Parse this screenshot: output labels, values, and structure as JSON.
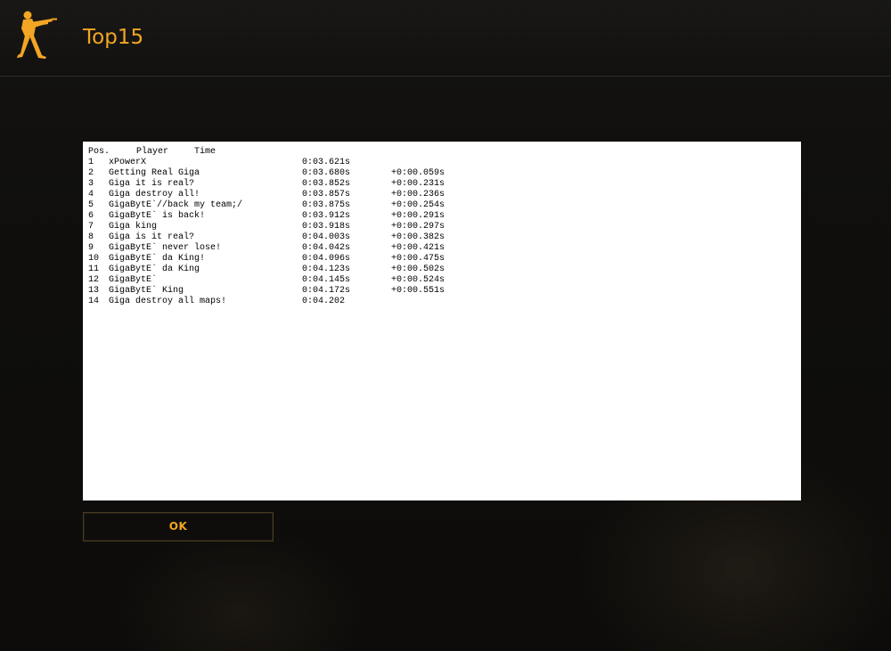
{
  "window": {
    "title": "Top15",
    "logo_icon": "counter-strike-soldier-icon",
    "accent_color": "#f3a623"
  },
  "table": {
    "headers": {
      "pos": "Pos.",
      "player": "Player",
      "time": "Time"
    },
    "rows": [
      {
        "pos": "1",
        "player": "xPowerX",
        "time": "0:03.621s",
        "diff": ""
      },
      {
        "pos": "2",
        "player": "Getting Real Giga",
        "time": "0:03.680s",
        "diff": "+0:00.059s"
      },
      {
        "pos": "3",
        "player": "Giga it is real?",
        "time": "0:03.852s",
        "diff": "+0:00.231s"
      },
      {
        "pos": "4",
        "player": "Giga destroy all!",
        "time": "0:03.857s",
        "diff": "+0:00.236s"
      },
      {
        "pos": "5",
        "player": "GigaBytE`//back my team;/",
        "time": "0:03.875s",
        "diff": "+0:00.254s"
      },
      {
        "pos": "6",
        "player": "GigaBytE` is back!",
        "time": "0:03.912s",
        "diff": "+0:00.291s"
      },
      {
        "pos": "7",
        "player": "Giga king",
        "time": "0:03.918s",
        "diff": "+0:00.297s"
      },
      {
        "pos": "8",
        "player": "Giga is it real?",
        "time": "0:04.003s",
        "diff": "+0:00.382s"
      },
      {
        "pos": "9",
        "player": "GigaBytE` never lose!",
        "time": "0:04.042s",
        "diff": "+0:00.421s"
      },
      {
        "pos": "10",
        "player": "GigaBytE` da King!",
        "time": "0:04.096s",
        "diff": "+0:00.475s"
      },
      {
        "pos": "11",
        "player": "GigaBytE` da King",
        "time": "0:04.123s",
        "diff": "+0:00.502s"
      },
      {
        "pos": "12",
        "player": "GigaBytE`",
        "time": "0:04.145s",
        "diff": "+0:00.524s"
      },
      {
        "pos": "13",
        "player": "GigaBytE` King",
        "time": "0:04.172s",
        "diff": "+0:00.551s"
      },
      {
        "pos": "14",
        "player": "Giga destroy all maps!",
        "time": "0:04.202",
        "diff": ""
      }
    ]
  },
  "buttons": {
    "ok_label": "OK"
  }
}
